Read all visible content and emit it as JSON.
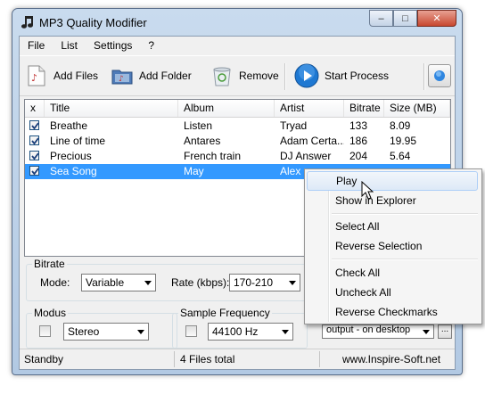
{
  "window": {
    "title": "MP3 Quality Modifier",
    "controls": {
      "minimize": "–",
      "maximize": "□",
      "close": "✕"
    }
  },
  "menu": [
    "File",
    "List",
    "Settings",
    "?"
  ],
  "toolbar": {
    "add_files": "Add Files",
    "add_folder": "Add Folder",
    "remove": "Remove",
    "start": "Start Process"
  },
  "list": {
    "columns": [
      "x",
      "Title",
      "Album",
      "Artist",
      "Bitrate",
      "Size (MB)"
    ],
    "rows": [
      {
        "checked": true,
        "title": "Breathe",
        "album": "Listen",
        "artist": "Tryad",
        "bitrate": "133",
        "size": "8.09",
        "selected": false
      },
      {
        "checked": true,
        "title": "Line of time",
        "album": "Antares",
        "artist": "Adam Certa...",
        "bitrate": "186",
        "size": "19.95",
        "selected": false
      },
      {
        "checked": true,
        "title": "Precious",
        "album": "French train",
        "artist": "DJ Answer",
        "bitrate": "204",
        "size": "5.64",
        "selected": false
      },
      {
        "checked": true,
        "title": "Sea Song",
        "album": "May",
        "artist": "Alex",
        "bitrate": "",
        "size": "",
        "selected": true
      }
    ]
  },
  "bitrate": {
    "label": "Bitrate",
    "mode_label": "Mode:",
    "mode_value": "Variable",
    "rate_label": "Rate (kbps):",
    "rate_value": "170-210"
  },
  "modus": {
    "label": "Modus",
    "value": "Stereo"
  },
  "frequency": {
    "label": "Sample Frequency",
    "value": "44100 Hz"
  },
  "output": {
    "value": "output - on desktop",
    "browse": "..."
  },
  "status": {
    "state": "Standby",
    "count": "4 Files total",
    "site": "www.Inspire-Soft.net"
  },
  "context_menu": {
    "items": [
      "Play",
      "Show in Explorer",
      "Select All",
      "Reverse Selection",
      "Check All",
      "Uncheck All",
      "Reverse Checkmarks"
    ]
  },
  "colors": {
    "selection": "#3399ff",
    "accent": "#1e78d2"
  }
}
